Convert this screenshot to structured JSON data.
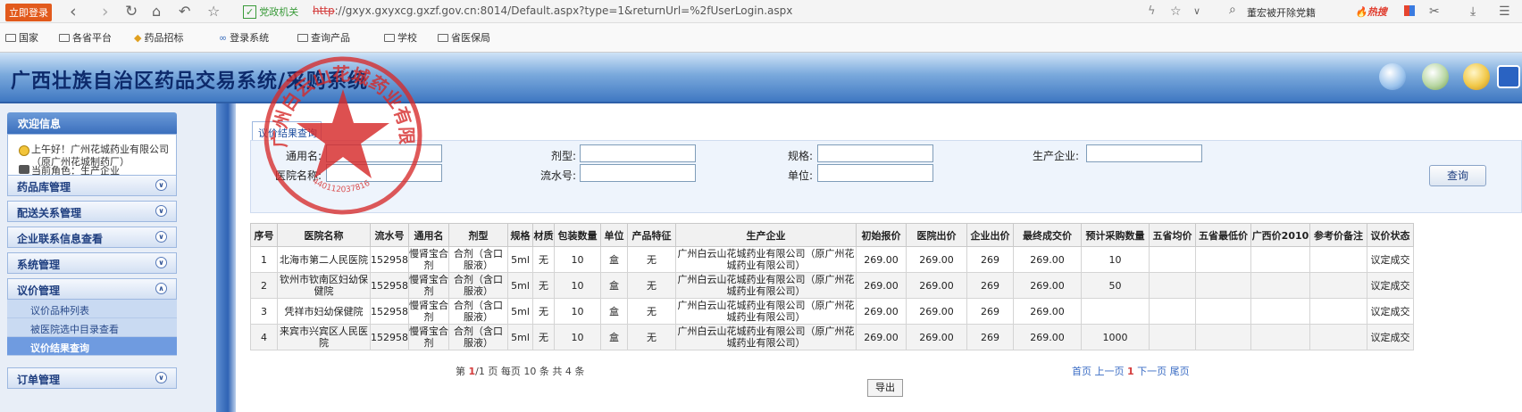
{
  "browser": {
    "login_badge": "立即登录",
    "site_badge": "党政机关",
    "url_protocol": "http",
    "url_rest": "://gxyx.gxyxcg.gxzf.gov.cn:8014/Default.aspx?type=1&returnUrl=%2fUserLogin.aspx",
    "search_text": "董宏被开除党籍",
    "hot_label": "热搜"
  },
  "bookmarks": [
    "国家",
    "各省平台",
    "药品招标",
    "登录系统",
    "查询产品",
    "学校",
    "省医保局"
  ],
  "app": {
    "title": "广西壮族自治区药品交易系统/采购系统"
  },
  "sidebar": {
    "welcome_header": "欢迎信息",
    "greeting": "上午好！广州花城药业有限公司（原广州花城制药厂）",
    "role": "当前角色：生产企业",
    "menus": [
      "药品库管理",
      "配送关系管理",
      "企业联系信息查看",
      "系统管理",
      "议价管理"
    ],
    "submenu": [
      "议价品种列表",
      "被医院选中目录查看",
      "议价结果查询"
    ],
    "last_menu": "订单管理"
  },
  "tab": {
    "label": "议价结果查询"
  },
  "query": {
    "generic_name_label": "通用名:",
    "dosage_form_label": "剂型:",
    "spec_label": "规格:",
    "manufacturer_label": "生产企业:",
    "hospital_label": "医院名称:",
    "serial_label": "流水号:",
    "unit_label": "单位:",
    "search_button": "查询"
  },
  "table": {
    "headers": [
      "序号",
      "医院名称",
      "流水号",
      "通用名",
      "剂型",
      "规格",
      "材质",
      "包装数量",
      "单位",
      "产品特征",
      "生产企业",
      "初始报价",
      "医院出价",
      "企业出价",
      "最终成交价",
      "预计采购数量",
      "五省均价",
      "五省最低价",
      "广西价2010",
      "参考价备注",
      "议价状态"
    ],
    "rows": [
      [
        "1",
        "北海市第二人民医院",
        "152958",
        "慢肾宝合剂",
        "合剂（含口服液）",
        "5ml",
        "无",
        "10",
        "盒",
        "无",
        "广州白云山花城药业有限公司（原广州花城药业有限公司）",
        "269.00",
        "269.00",
        "269",
        "269.00",
        "10",
        "",
        "",
        "",
        "",
        "议定成交"
      ],
      [
        "2",
        "钦州市钦南区妇幼保健院",
        "152958",
        "慢肾宝合剂",
        "合剂（含口服液）",
        "5ml",
        "无",
        "10",
        "盒",
        "无",
        "广州白云山花城药业有限公司（原广州花城药业有限公司）",
        "269.00",
        "269.00",
        "269",
        "269.00",
        "50",
        "",
        "",
        "",
        "",
        "议定成交"
      ],
      [
        "3",
        "凭祥市妇幼保健院",
        "152958",
        "慢肾宝合剂",
        "合剂（含口服液）",
        "5ml",
        "无",
        "10",
        "盒",
        "无",
        "广州白云山花城药业有限公司（原广州花城药业有限公司）",
        "269.00",
        "269.00",
        "269",
        "269.00",
        "",
        "",
        "",
        "",
        "",
        "议定成交"
      ],
      [
        "4",
        "来宾市兴宾区人民医院",
        "152958",
        "慢肾宝合剂",
        "合剂（含口服液）",
        "5ml",
        "无",
        "10",
        "盒",
        "无",
        "广州白云山花城药业有限公司（原广州花城药业有限公司）",
        "269.00",
        "269.00",
        "269",
        "269.00",
        "1000",
        "",
        "",
        "",
        "",
        "议定成交"
      ]
    ]
  },
  "pager": {
    "left_prefix": "第",
    "current": "1",
    "left_suffix": "/1 页 每页 10 条 共 4 条",
    "first": "首页",
    "prev": "上一页",
    "page": "1",
    "next": "下一页",
    "last": "尾页"
  },
  "export": {
    "label": "导出"
  },
  "seal": {
    "text": "广州白云山花城药业有限公司",
    "code": "440112037816"
  },
  "colors": {
    "header_dark": "#2d5fa8",
    "seal_red": "#d62a2a",
    "link_blue": "#3a6cc4"
  }
}
